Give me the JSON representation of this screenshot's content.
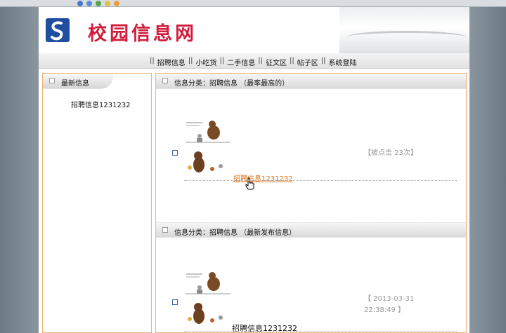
{
  "browser": {
    "title_fragment": "",
    "toolbar_icons": [
      "blue-circle-icon",
      "blue-circle-icon",
      "green-icon",
      "yellow-icon",
      "orange-icon"
    ]
  },
  "site": {
    "title": "校园信息网",
    "brand_color": "#d21c3c"
  },
  "nav": {
    "items": [
      {
        "label": "招聘信息"
      },
      {
        "label": "小吃货"
      },
      {
        "label": "二手信息"
      },
      {
        "label": "征文区"
      },
      {
        "label": "帖子区"
      },
      {
        "label": "系统登陆"
      }
    ]
  },
  "sidebar": {
    "heading": "最新信息",
    "items": [
      {
        "label": "招聘信息1231232"
      }
    ]
  },
  "sections": [
    {
      "heading": "信息分类：招聘信息 （最率最高的）",
      "post_title": "招聘信息1231232",
      "meta_line1": "【被点击 23次】",
      "meta_line2": ""
    },
    {
      "heading": "信息分类：招聘信息 （最新发布信息）",
      "post_title": "招聘信息1231232",
      "meta_line1": "【 2013-03-31",
      "meta_line2": "22:38:49 】"
    }
  ]
}
